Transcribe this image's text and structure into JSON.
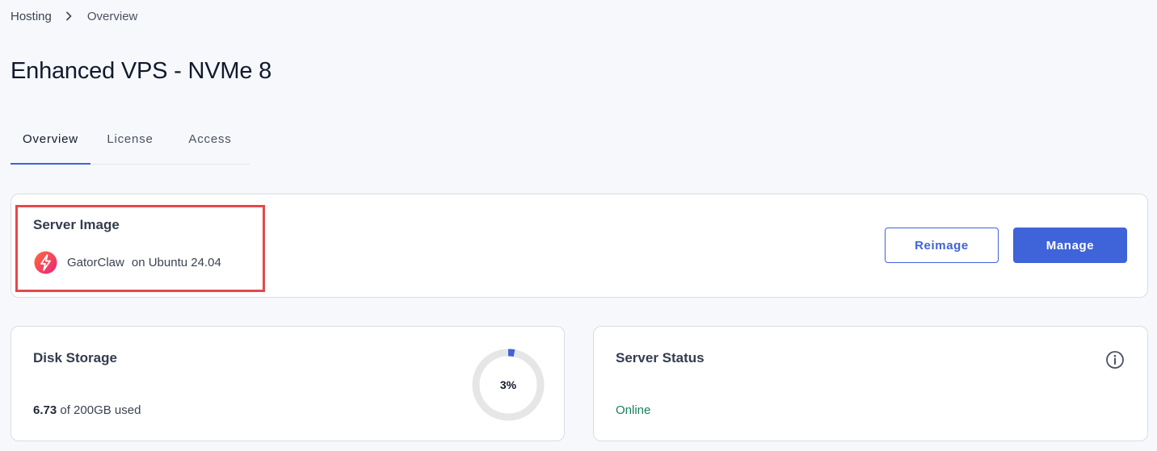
{
  "breadcrumb": {
    "root": "Hosting",
    "current": "Overview"
  },
  "page": {
    "title": "Enhanced VPS - NVMe 8"
  },
  "tabs": [
    {
      "label": "Overview",
      "active": true
    },
    {
      "label": "License",
      "active": false
    },
    {
      "label": "Access",
      "active": false
    }
  ],
  "server_image": {
    "title": "Server Image",
    "app_name": "GatorClaw",
    "os_text": "on Ubuntu 24.04",
    "logo_icon": "lightning-bolt-icon",
    "reimage_label": "Reimage",
    "manage_label": "Manage"
  },
  "disk": {
    "title": "Disk Storage",
    "used": "6.73",
    "total_text": "of 200GB used",
    "percent_label": "3%",
    "percent": 3
  },
  "status": {
    "title": "Server Status",
    "value": "Online",
    "info_icon": "info-icon"
  },
  "colors": {
    "accent": "#3f63d8",
    "highlight": "#e5484d",
    "online": "#19805a",
    "donut_track": "#e6e6e6"
  }
}
